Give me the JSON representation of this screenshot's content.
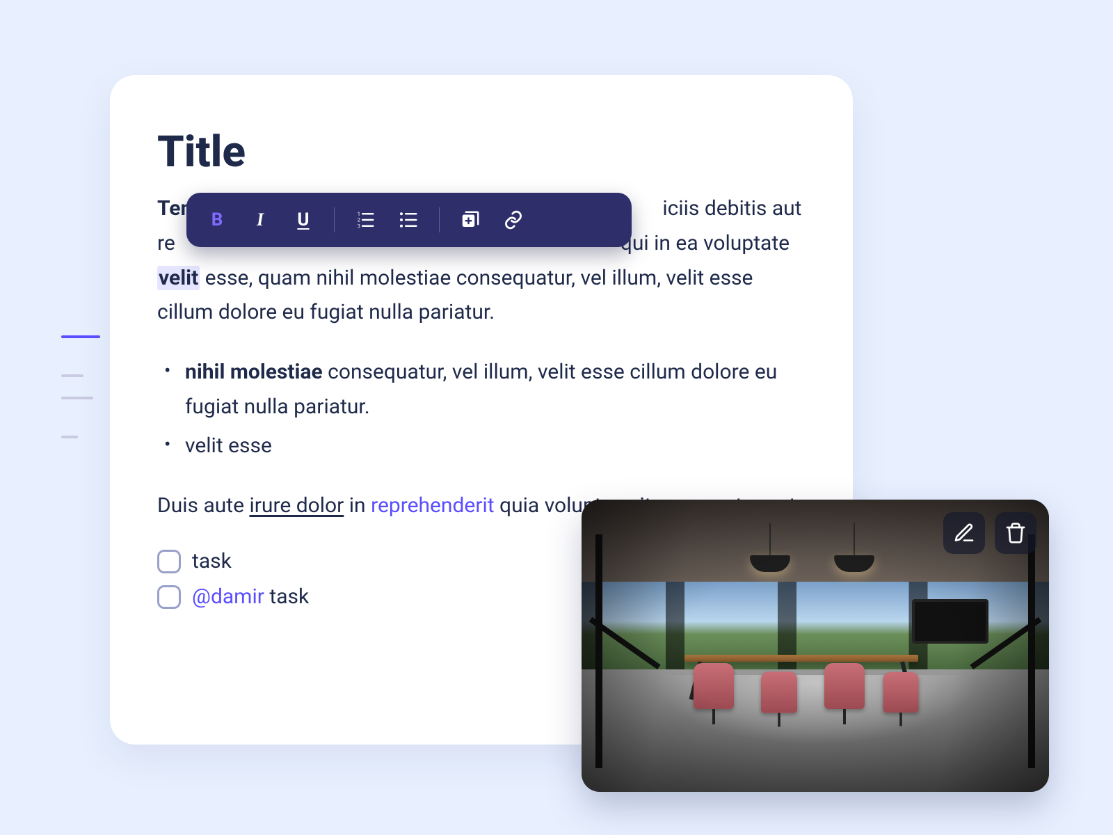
{
  "title": "Title",
  "para1": {
    "lead": "Temp",
    "after_toolbar": "iciis debitis aut re",
    "tail": "qui in ea voluptate ",
    "highlight": "velit",
    "rest": " esse, quam nihil molestiae consequatur, vel illum, velit esse cillum dolore eu fugiat nulla pariatur."
  },
  "bullets": [
    {
      "bold": "nihil molestiae",
      "rest": " consequatur, vel illum, velit esse cillum dolore eu fugiat nulla pariatur."
    },
    {
      "bold": "",
      "rest": "velit esse"
    }
  ],
  "para2": {
    "pre": "Duis aute ",
    "underline": "irure dolor",
    "mid": " in ",
    "link": "reprehenderit",
    "post": " quia voluptas sit, aspernatur aut"
  },
  "tasks": [
    {
      "mention": "",
      "label": "task"
    },
    {
      "mention": "@damir",
      "label": " task"
    }
  ],
  "toolbar": {
    "bold": "B",
    "italic": "I",
    "underline": "U"
  }
}
